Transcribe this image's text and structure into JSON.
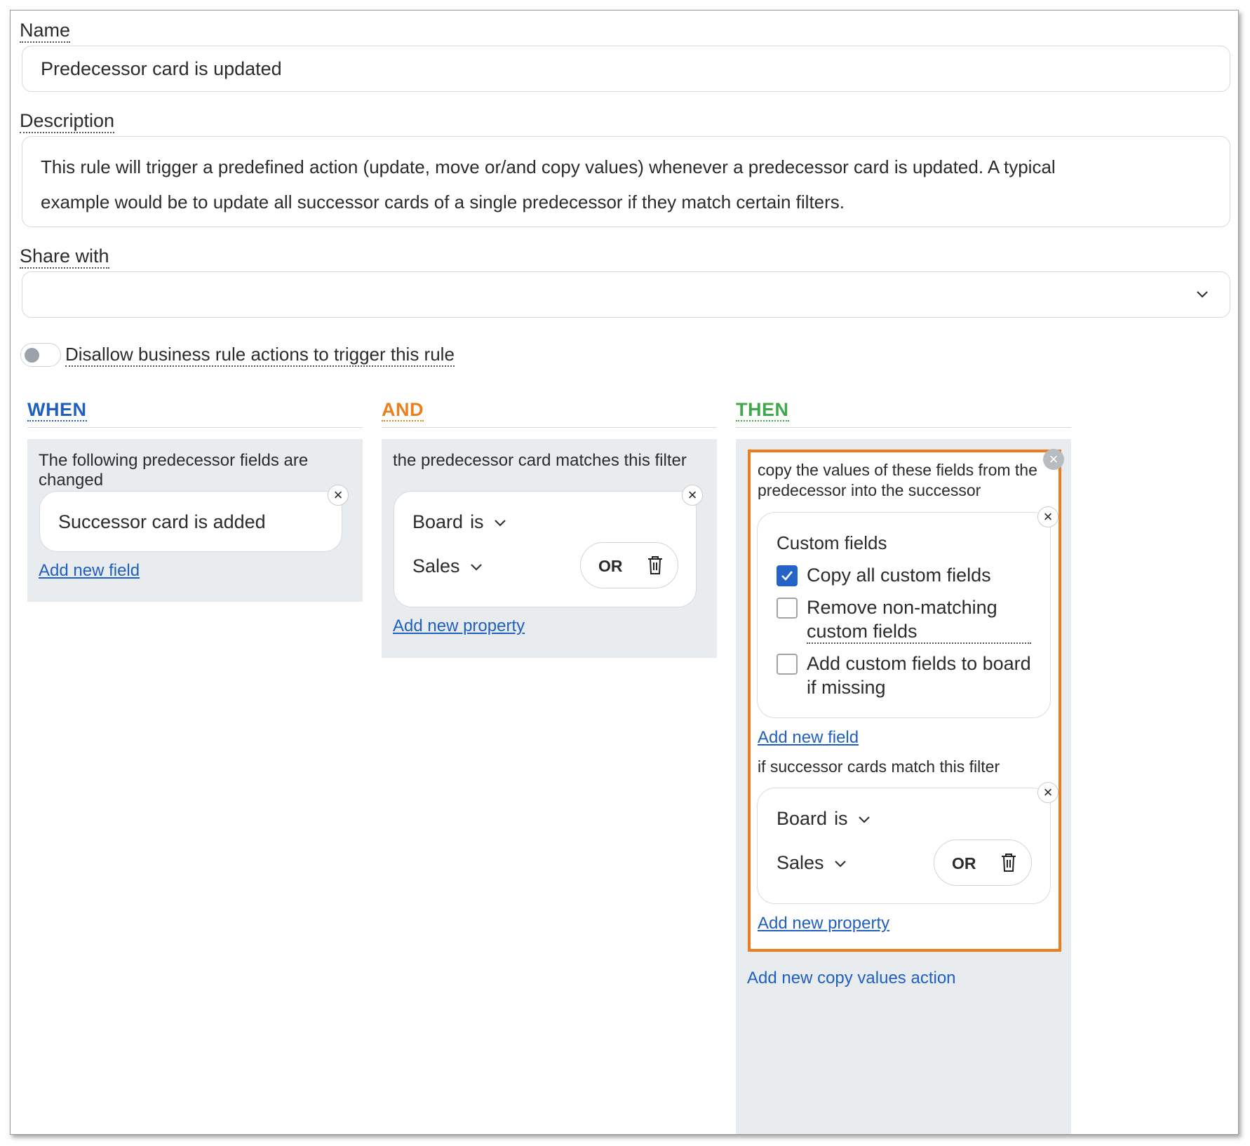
{
  "form": {
    "name_label": "Name",
    "name_value": "Predecessor card is updated",
    "description_label": "Description",
    "description_value": "This rule will trigger a predefined action (update, move or/and copy values) whenever a predecessor card is updated. A typical example would be to update all successor cards of a single predecessor if they match certain filters.",
    "share_label": "Share with",
    "share_value": "",
    "toggle_label": "Disallow business rule actions to trigger this rule",
    "toggle_on": false
  },
  "colors": {
    "when": "#1f5fbf",
    "and": "#e8801c",
    "then": "#3fa84a",
    "link": "#1f5fbf",
    "highlight": "#ec7c1e",
    "checkbox": "#2563c9"
  },
  "when": {
    "heading": "WHEN",
    "title": "The following predecessor fields are changed",
    "field": "Successor card is added",
    "add_link": "Add new field"
  },
  "and": {
    "heading": "AND",
    "title": "the predecessor card matches this filter",
    "property": "Board",
    "operator": "is",
    "value": "Sales",
    "or_label": "OR",
    "add_link": "Add new property"
  },
  "then": {
    "heading": "THEN",
    "copy_title": "copy the values of these fields from the predecessor into the successor",
    "section_title": "Custom fields",
    "options": [
      {
        "label": "Copy all custom fields",
        "checked": true
      },
      {
        "label": "Remove non-matching custom fields",
        "checked": false
      },
      {
        "label": "Add custom fields to board if missing",
        "checked": false
      }
    ],
    "add_field_link": "Add new field",
    "filter_title": "if successor cards match this filter",
    "property": "Board",
    "operator": "is",
    "value": "Sales",
    "or_label": "OR",
    "add_property_link": "Add new property",
    "add_action_link": "Add new copy values action"
  }
}
